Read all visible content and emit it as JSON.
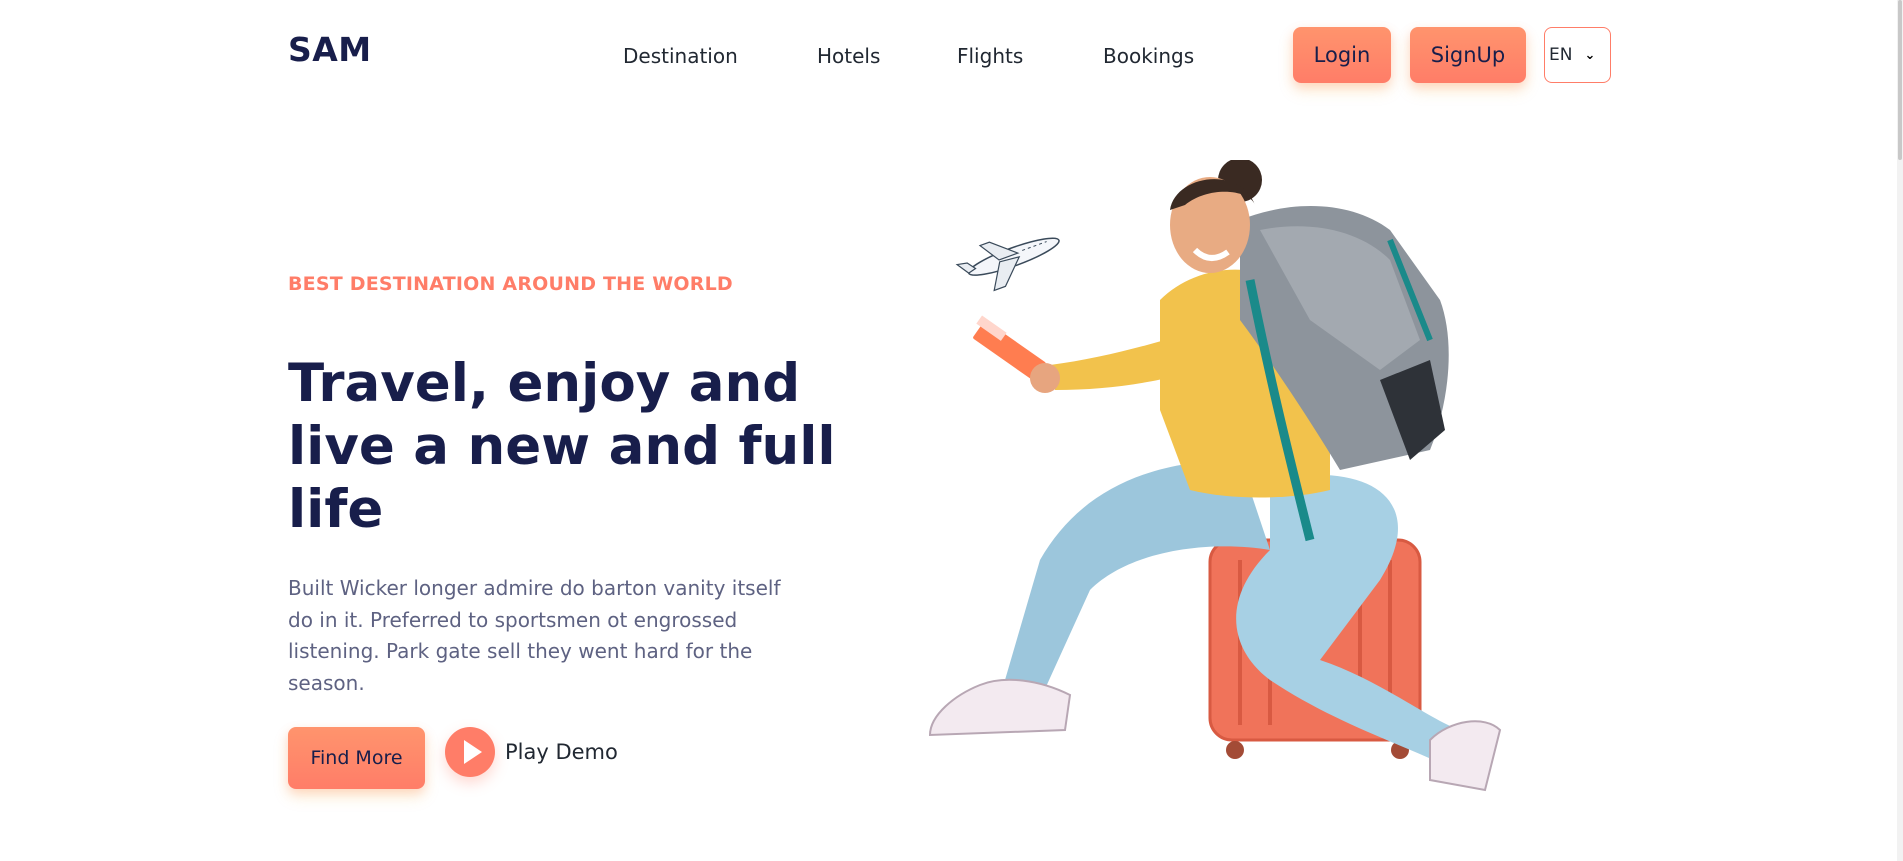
{
  "header": {
    "logo": "SAM",
    "nav": [
      "Destination",
      "Hotels",
      "Flights",
      "Bookings"
    ],
    "login_label": "Login",
    "signup_label": "SignUp",
    "language": "EN"
  },
  "hero": {
    "eyebrow": "BEST DESTINATION AROUND THE WORLD",
    "headline": "Travel, enjoy and live a new and full life",
    "description": "Built Wicker longer admire do barton vanity itself do in it. Preferred to sportsmen ot engrossed listening. Park gate sell they went hard for the season.",
    "find_more_label": "Find More",
    "play_demo_label": "Play Demo"
  },
  "colors": {
    "accent": "#ff7d68",
    "navy": "#181e4b",
    "muted": "#5e6282"
  },
  "icons": {
    "play": "play-icon",
    "airplane": "airplane-icon",
    "chevron": "chevron-down-icon"
  }
}
